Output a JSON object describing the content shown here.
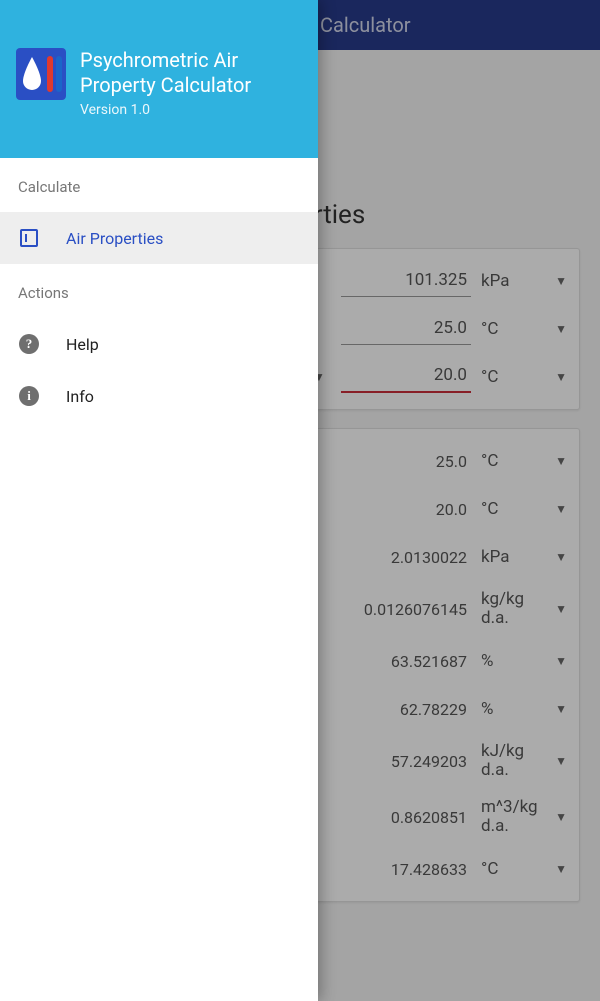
{
  "bg": {
    "appbar_title": "Calculator",
    "section_title": "erties",
    "inputs": [
      {
        "value": "101.325",
        "unit": "kPa",
        "hl": false,
        "left_dd": false
      },
      {
        "value": "25.0",
        "unit": "°C",
        "hl": false,
        "left_dd": false
      },
      {
        "value": "20.0",
        "unit": "°C",
        "hl": true,
        "left_dd": true
      }
    ],
    "outputs": [
      {
        "value": "25.0",
        "unit": "°C",
        "tall": false
      },
      {
        "value": "20.0",
        "unit": "°C",
        "tall": false
      },
      {
        "value": "2.0130022",
        "unit": "kPa",
        "tall": false
      },
      {
        "value": "0.0126076145",
        "unit": "kg/kg d.a.",
        "tall": true
      },
      {
        "value": "63.521687",
        "unit": "%",
        "tall": false
      },
      {
        "value": "62.78229",
        "unit": "%",
        "tall": false
      },
      {
        "value": "57.249203",
        "unit": "kJ/kg d.a.",
        "tall": true
      },
      {
        "value": "0.8620851",
        "unit": "m^3/kg d.a.",
        "tall": true
      },
      {
        "value": "17.428633",
        "unit": "°C",
        "tall": false
      }
    ]
  },
  "drawer": {
    "title": "Psychrometric Air Property Calculator",
    "version": "Version 1.0",
    "section_calc": "Calculate",
    "section_actions": "Actions",
    "items": {
      "air_properties": "Air Properties",
      "help": "Help",
      "info": "Info"
    }
  }
}
